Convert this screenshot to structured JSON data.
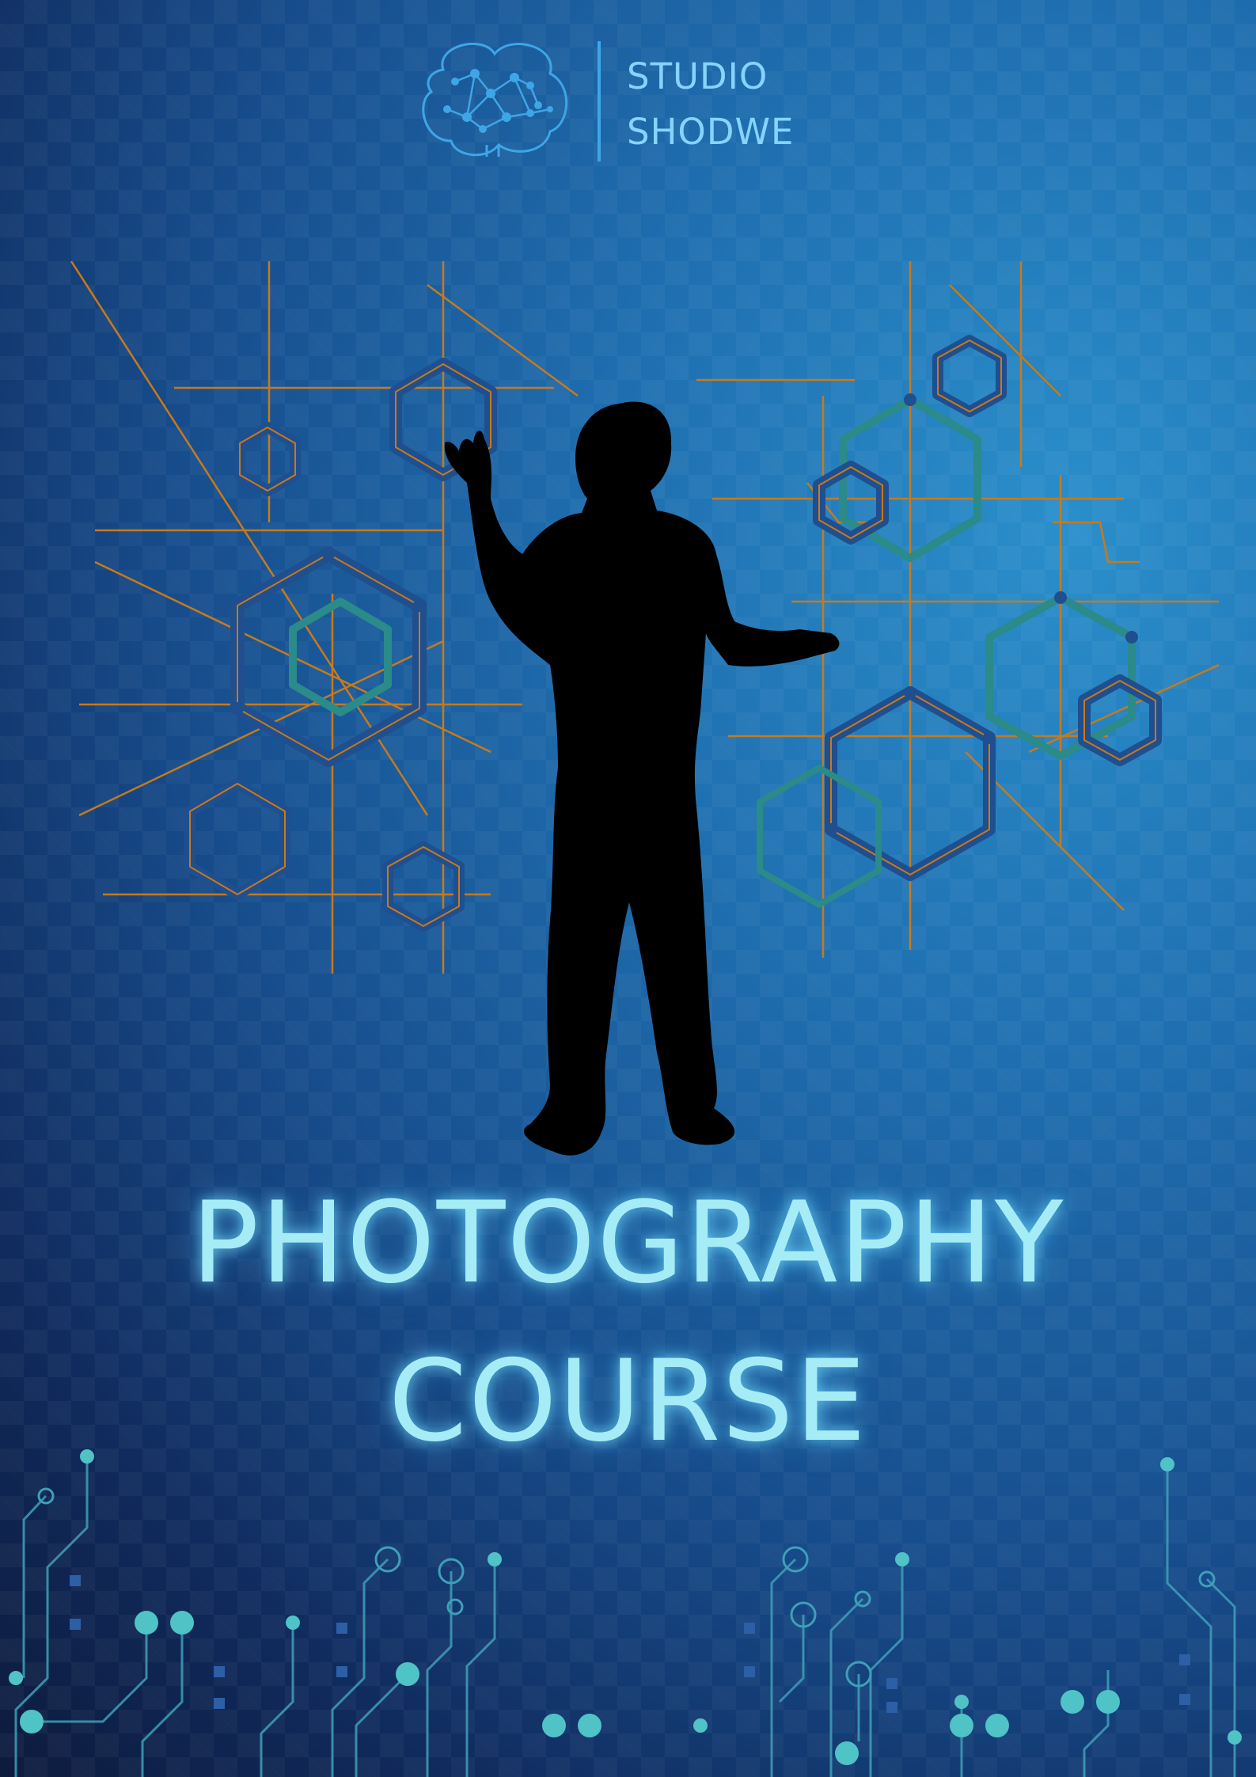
{
  "logo": {
    "icon": "brain-network-icon",
    "line1": "STUDIO",
    "line2": "SHODWE"
  },
  "title": {
    "line1": "PHOTOGRAPHY",
    "line2": "COURSE"
  },
  "colors": {
    "background_dark": "#0d1b3d",
    "background_light": "#2a8fcb",
    "title_text": "#a6ecf6",
    "logo_text": "#86d3ff",
    "hex_lines": "#c77a1c",
    "hex_fill": "#1f4f8e",
    "circuit": "#4fc3c6"
  }
}
